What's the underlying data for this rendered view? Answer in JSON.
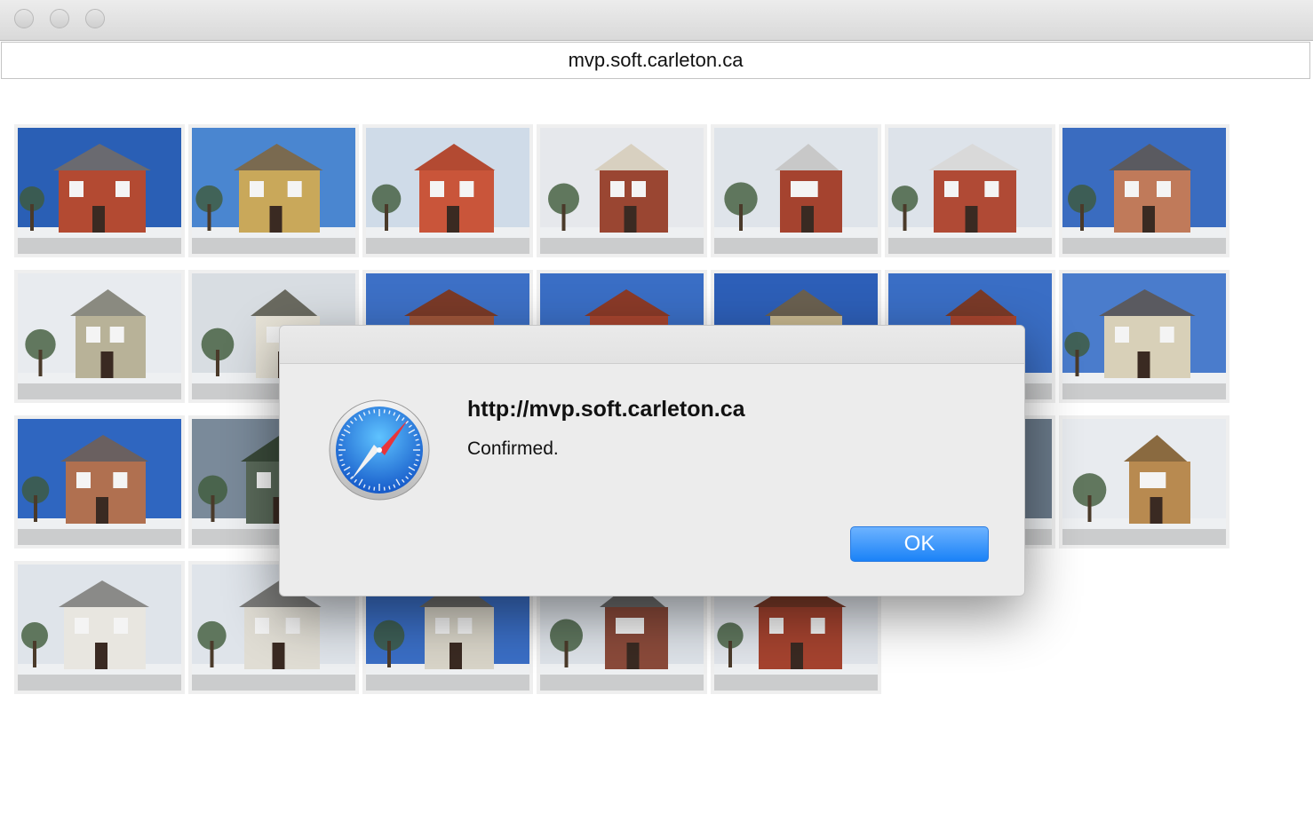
{
  "window": {
    "address": "mvp.soft.carleton.ca"
  },
  "photos": [
    {
      "row": 0,
      "col": 0,
      "sky": "#2a5fb5",
      "wall": "#b34a32",
      "roof": "#6a6a70"
    },
    {
      "row": 0,
      "col": 1,
      "sky": "#4a86d0",
      "wall": "#c9a85a",
      "roof": "#7a6a50"
    },
    {
      "row": 0,
      "col": 2,
      "sky": "#cfdbe8",
      "wall": "#c9553a",
      "roof": "#b34a32"
    },
    {
      "row": 0,
      "col": 3,
      "sky": "#e6e8ec",
      "wall": "#9a4632",
      "roof": "#d8d0c0"
    },
    {
      "row": 0,
      "col": 4,
      "sky": "#dfe4ea",
      "wall": "#a5432f",
      "roof": "#c8c8c8"
    },
    {
      "row": 0,
      "col": 5,
      "sky": "#dde3ea",
      "wall": "#b04a35",
      "roof": "#d9d9d9"
    },
    {
      "row": 0,
      "col": 6,
      "sky": "#3a6cc0",
      "wall": "#c07a5a",
      "roof": "#5a5a60"
    },
    {
      "row": 1,
      "col": 0,
      "sky": "#e8ebef",
      "wall": "#b8b298",
      "roof": "#8a8a80"
    },
    {
      "row": 1,
      "col": 1,
      "sky": "#d8dde2",
      "wall": "#e8e4d8",
      "roof": "#6a6a60"
    },
    {
      "row": 1,
      "col": 2,
      "sky": "#3d70c6",
      "wall": "#a0563a",
      "roof": "#7a3a28"
    },
    {
      "row": 1,
      "col": 3,
      "sky": "#3a6ec5",
      "wall": "#a8452f",
      "roof": "#8a3a28"
    },
    {
      "row": 1,
      "col": 4,
      "sky": "#2d5fb8",
      "wall": "#c8b890",
      "roof": "#6a6050"
    },
    {
      "row": 1,
      "col": 5,
      "sky": "#3a6ec5",
      "wall": "#a8452f",
      "roof": "#7a3a28"
    },
    {
      "row": 1,
      "col": 6,
      "sky": "#4a7ccc",
      "wall": "#d8d0b8",
      "roof": "#5a5a60"
    },
    {
      "row": 2,
      "col": 0,
      "sky": "#2f66c0",
      "wall": "#b07050",
      "roof": "#6a6060"
    },
    {
      "row": 2,
      "col": 1,
      "sky": "#7a8a9a",
      "wall": "#5a6a5a",
      "roof": "#3a4a3a"
    },
    {
      "row": 2,
      "col": 5,
      "sky": "#6a7a8a",
      "wall": "#5a6a5a",
      "roof": "#4a4a4a"
    },
    {
      "row": 2,
      "col": 6,
      "sky": "#e8ebef",
      "wall": "#b88a50",
      "roof": "#8a6a40"
    },
    {
      "row": 3,
      "col": 0,
      "sky": "#dfe4ea",
      "wall": "#e8e6e0",
      "roof": "#8a8a88"
    },
    {
      "row": 3,
      "col": 1,
      "sky": "#dfe4ea",
      "wall": "#e0ddd4",
      "roof": "#7a7a78"
    },
    {
      "row": 3,
      "col": 2,
      "sky": "#3a6ec5",
      "wall": "#d8d4c8",
      "roof": "#6a6a68"
    },
    {
      "row": 3,
      "col": 3,
      "sky": "#dde2e8",
      "wall": "#8a4a3a",
      "roof": "#6a6a6a"
    },
    {
      "row": 3,
      "col": 4,
      "sky": "#e0e4ea",
      "wall": "#a5432f",
      "roof": "#7a3a28"
    }
  ],
  "dialog": {
    "title": "http://mvp.soft.carleton.ca",
    "message": "Confirmed.",
    "ok_label": "OK",
    "icon": "safari-compass-icon"
  }
}
